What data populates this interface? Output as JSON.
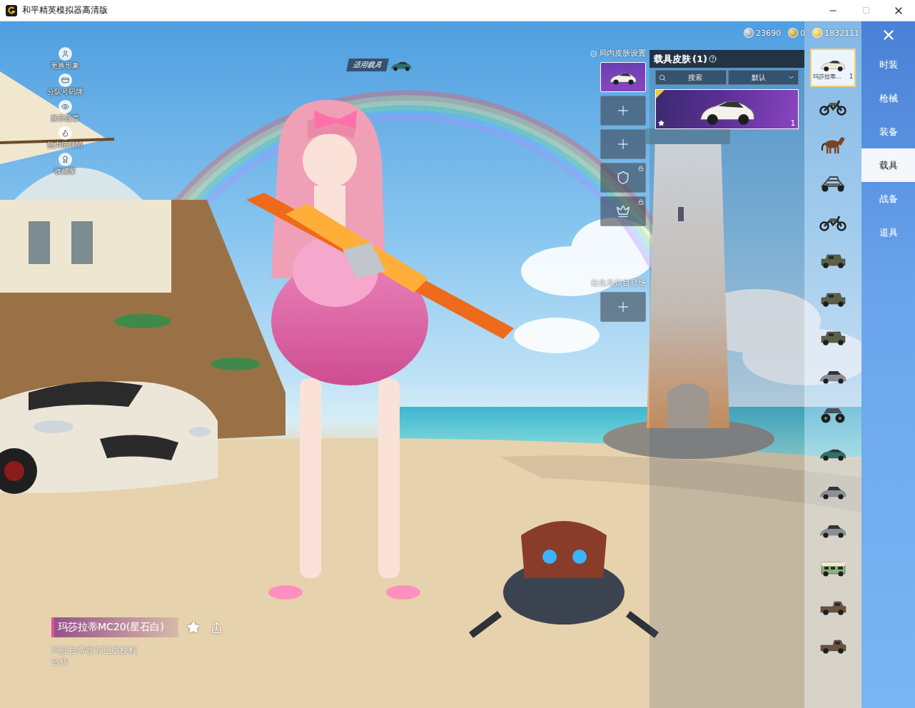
{
  "window": {
    "title": "和平精英模拟器高清版"
  },
  "currencies": [
    {
      "value": "23690",
      "kind": "silver"
    },
    {
      "value": "0",
      "kind": "gold"
    },
    {
      "value": "1832111",
      "kind": "coin"
    }
  ],
  "lobby_menu": [
    {
      "label": "更换形象"
    },
    {
      "label": "分队号码牌"
    },
    {
      "label": "展示设置"
    },
    {
      "label": "热力值详情"
    },
    {
      "label": "收藏家"
    }
  ],
  "vehicle_tag": {
    "label": "适用载具"
  },
  "in_game_skin": {
    "title": "局内皮肤设置",
    "slots": [
      {
        "kind": "vehicle",
        "selected": true,
        "locked": false
      },
      {
        "kind": "empty",
        "selected": false,
        "locked": false
      },
      {
        "kind": "empty",
        "selected": false,
        "locked": false
      },
      {
        "kind": "badge",
        "selected": false,
        "locked": true
      },
      {
        "kind": "crown",
        "selected": false,
        "locked": true
      }
    ]
  },
  "spawn_entrance": {
    "title": "出生岛炫目登场",
    "slots": [
      {
        "kind": "empty",
        "selected": false,
        "locked": false
      }
    ]
  },
  "skin_panel": {
    "title": "载具皮肤",
    "count": "(1)",
    "search": {
      "placeholder": "搜索"
    },
    "sort": {
      "value": "默认"
    },
    "cards": [
      {
        "quantity": "1",
        "selected": true,
        "equipped": true,
        "favorite": true
      }
    ]
  },
  "vehicle_types": [
    {
      "kind": "sportscar",
      "label": "玛莎拉蒂...",
      "quantity": "1",
      "selected": true
    },
    {
      "kind": "motorcycle",
      "selected": false
    },
    {
      "kind": "horse",
      "selected": false
    },
    {
      "kind": "buggy",
      "selected": false
    },
    {
      "kind": "motorcycle",
      "selected": false
    },
    {
      "kind": "jeep",
      "selected": false
    },
    {
      "kind": "jeep",
      "selected": false
    },
    {
      "kind": "jeep",
      "selected": false
    },
    {
      "kind": "sedan",
      "selected": false
    },
    {
      "kind": "monster",
      "selected": false
    },
    {
      "kind": "coupe",
      "selected": false
    },
    {
      "kind": "sedan",
      "selected": false
    },
    {
      "kind": "sedan",
      "selected": false
    },
    {
      "kind": "van",
      "selected": false
    },
    {
      "kind": "pickup",
      "selected": false
    },
    {
      "kind": "pickup",
      "selected": false
    }
  ],
  "tabs": [
    {
      "label": "时装",
      "selected": false
    },
    {
      "label": "枪械",
      "selected": false
    },
    {
      "label": "装备",
      "selected": false
    },
    {
      "label": "载具",
      "selected": true
    },
    {
      "label": "战备",
      "selected": false
    },
    {
      "label": "道具",
      "selected": false
    }
  ],
  "item_info": {
    "name": "玛莎拉蒂MC20(星石白)",
    "description": [
      "玛莎拉蒂官方正版授权",
      "合作"
    ]
  }
}
